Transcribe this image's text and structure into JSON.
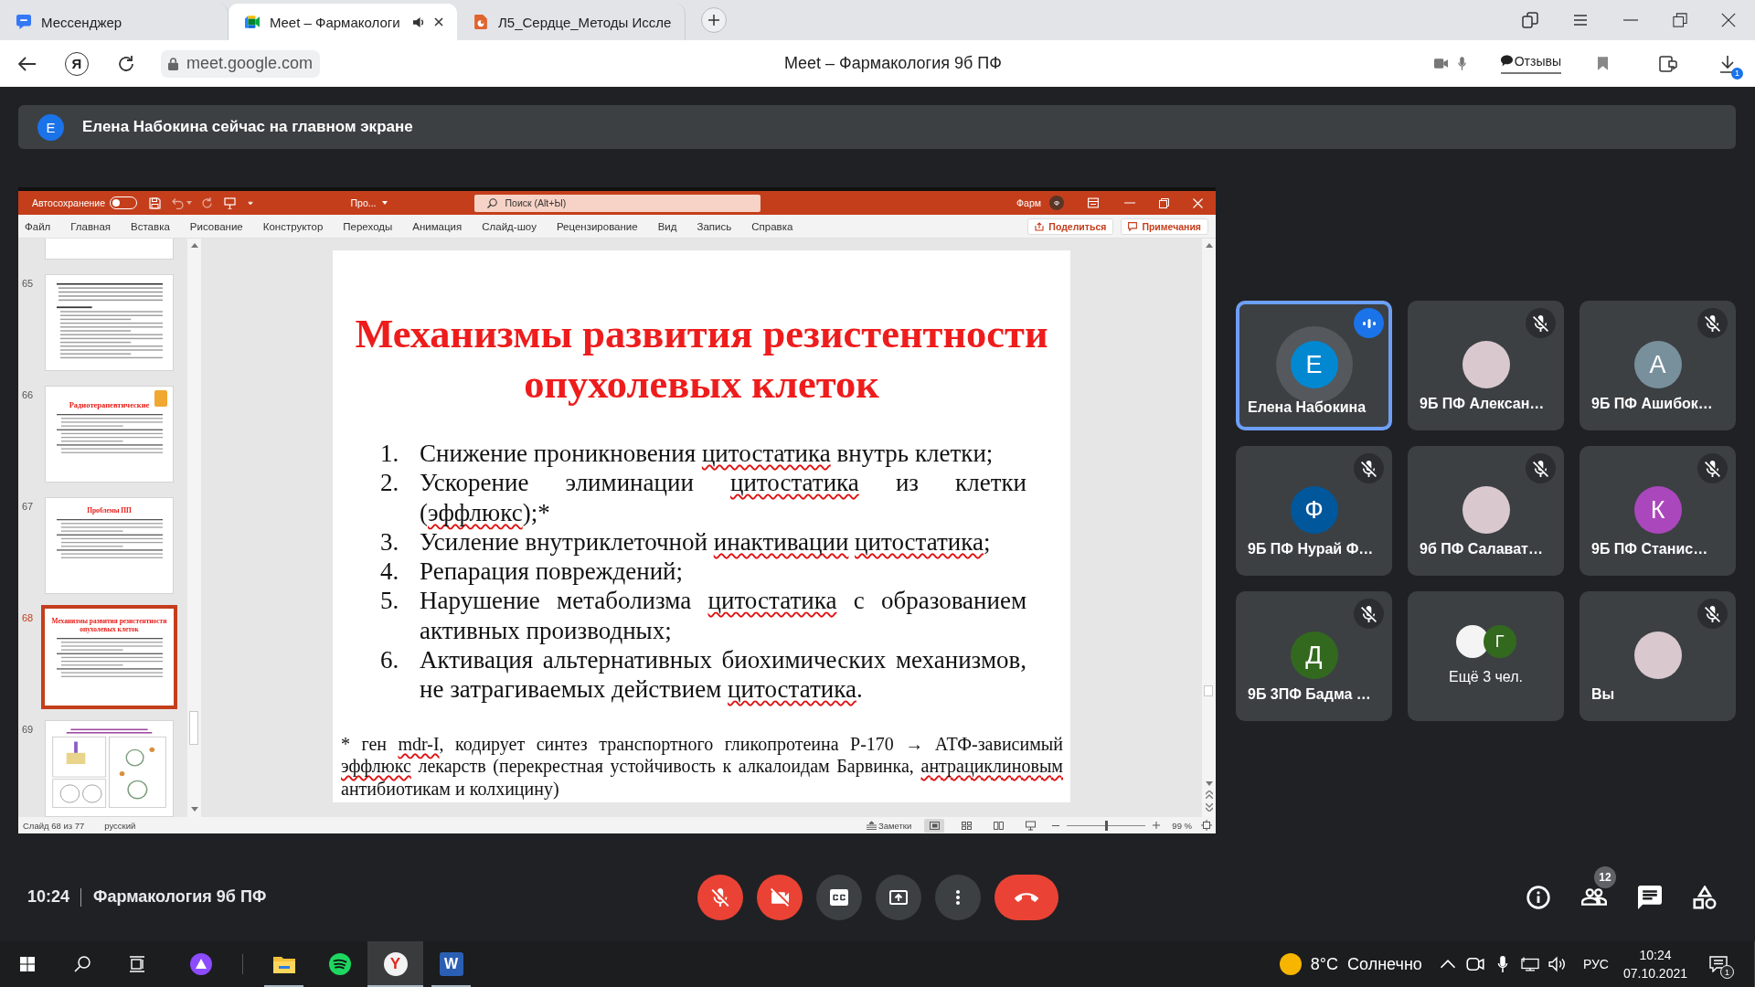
{
  "browser": {
    "tabs": [
      {
        "kind": "messenger",
        "title": "Мессенджер",
        "selected": false,
        "audio": false
      },
      {
        "kind": "meet",
        "title": "Meet – Фармакологи",
        "selected": true,
        "audio": true
      },
      {
        "kind": "document",
        "title": "Л5_Сердце_Методы Иссле",
        "selected": false,
        "audio": false
      }
    ],
    "home_glyph": "Я",
    "address": "meet.google.com",
    "page_title": "Meet – Фармакология 9б ПФ",
    "feedback": "Отзывы",
    "downloads_badge": "1"
  },
  "banner": {
    "avatar": "Е",
    "text": "Елена Набокина сейчас на главном экране"
  },
  "presentation": {
    "titlebar": {
      "autosave": "Автосохранение",
      "autosave_on": false,
      "file": "Про...",
      "search_placeholder": "Поиск (Alt+Ы)",
      "user": "Фарм",
      "user_avatar": "Ф"
    },
    "menu": [
      "Файл",
      "Главная",
      "Вставка",
      "Рисование",
      "Конструктор",
      "Переходы",
      "Анимация",
      "Слайд-шоу",
      "Рецензирование",
      "Вид",
      "Запись",
      "Справка"
    ],
    "share": "Поделиться",
    "comments": "Примечания",
    "thumbnails": [
      {
        "kind": "cut",
        "selected": false
      },
      {
        "number": "65",
        "kind": "text",
        "selected": false
      },
      {
        "number": "66",
        "kind": "title-image",
        "title": "Радиотерапевтические",
        "selected": false
      },
      {
        "number": "67",
        "kind": "title",
        "title": "Проблемы ПП",
        "selected": false
      },
      {
        "number": "68",
        "kind": "title",
        "title": "Механизмы развития резистентности опухолевых клеток",
        "selected": true
      },
      {
        "number": "69",
        "kind": "figure",
        "selected": false
      }
    ],
    "slide": {
      "title": "Механизмы развития резистентности опухолевых клеток",
      "items": [
        {
          "number": "1.",
          "parts": [
            {
              "text": "Снижение проникновения ",
              "misspelled": false
            },
            {
              "text": "цитостатика",
              "misspelled": true
            },
            {
              "text": " внутрь клетки;",
              "misspelled": false
            }
          ]
        },
        {
          "number": "2.",
          "parts": [
            {
              "text": "Ускорение элиминации ",
              "misspelled": false
            },
            {
              "text": "цитостатика",
              "misspelled": true
            },
            {
              "text": " из клетки (",
              "misspelled": false
            },
            {
              "text": "эффлюкс",
              "misspelled": true
            },
            {
              "text": ");*",
              "misspelled": false
            }
          ]
        },
        {
          "number": "3.",
          "parts": [
            {
              "text": "Усиление внутриклеточной ",
              "misspelled": false
            },
            {
              "text": "инактивации",
              "misspelled": true
            },
            {
              "text": " цитостатика",
              "misspelled": true
            },
            {
              "text": ";",
              "misspelled": false
            }
          ]
        },
        {
          "number": "4.",
          "parts": [
            {
              "text": "Репарация повреждений;",
              "misspelled": false
            }
          ]
        },
        {
          "number": "5.",
          "parts": [
            {
              "text": "Нарушение метаболизма ",
              "misspelled": false
            },
            {
              "text": "цитостатика",
              "misspelled": true
            },
            {
              "text": " с образованием активных производных;",
              "misspelled": false
            }
          ]
        },
        {
          "number": "6.",
          "parts": [
            {
              "text": "Активация альтернативных биохимических механизмов, не затрагиваемых действием ",
              "misspelled": false
            },
            {
              "text": "цитостатика",
              "misspelled": true
            },
            {
              "text": ".",
              "misspelled": false
            }
          ]
        }
      ],
      "footnote": [
        {
          "text": "* ген ",
          "misspelled": false
        },
        {
          "text": "mdr-I",
          "misspelled": true
        },
        {
          "text": ", кодирует синтез транспортного гликопротеина Р-170 → АТФ-зависимый ",
          "misspelled": false
        },
        {
          "text": "эффлюкс",
          "misspelled": true
        },
        {
          "text": " лекарств (перекрестная устойчивость к алкалоидам Барвинка, ",
          "misspelled": false
        },
        {
          "text": "антрациклиновым",
          "misspelled": true
        },
        {
          "text": " антибиотикам и колхицину)",
          "misspelled": false
        }
      ]
    },
    "status": {
      "slide": "Слайд 68 из 77",
      "language": "русский",
      "notes": "Заметки",
      "views": [
        {
          "kind": "normal",
          "selected": true
        },
        {
          "kind": "sorter",
          "selected": false
        },
        {
          "kind": "reading",
          "selected": false
        },
        {
          "kind": "slideshow",
          "selected": false
        }
      ],
      "zoom_slider": {
        "level": 0.5
      },
      "zoom": "99 %"
    }
  },
  "participants": [
    {
      "kind": "letter",
      "name": "Елена Набокина",
      "letter": "Е",
      "color": "#0288d1",
      "speaking": true,
      "muted": false
    },
    {
      "kind": "photo",
      "name": "9Б ПФ Алексан…",
      "speaking": false,
      "muted": true
    },
    {
      "kind": "letter",
      "name": "9Б ПФ Ашибок…",
      "letter": "А",
      "color": "#78909c",
      "speaking": false,
      "muted": true
    },
    {
      "kind": "letter",
      "name": "9Б ПФ Нурай Ф…",
      "letter": "Ф",
      "color": "#01579b",
      "speaking": false,
      "muted": true
    },
    {
      "kind": "photo",
      "name": "9б ПФ Салават…",
      "speaking": false,
      "muted": true
    },
    {
      "kind": "letter",
      "name": "9Б ПФ Станис…",
      "letter": "К",
      "color": "#ab47bc",
      "speaking": false,
      "muted": true
    },
    {
      "kind": "letter",
      "name": "9Б 3ПФ Бадма …",
      "letter": "Д",
      "color": "#33691e",
      "speaking": false,
      "muted": true
    },
    {
      "kind": "more",
      "label": "Ещё 3 чел.",
      "avatars": [
        {
          "kind": "photo"
        },
        {
          "kind": "letter",
          "letter": "Г",
          "color": "#33691e"
        }
      ],
      "speaking": false,
      "muted": false
    },
    {
      "kind": "photo",
      "name": "Вы",
      "speaking": false,
      "muted": true
    }
  ],
  "call": {
    "time": "10:24",
    "title": "Фармакология 9б ПФ",
    "controls": [
      {
        "kind": "mic",
        "on": false
      },
      {
        "kind": "camera",
        "on": false
      },
      {
        "kind": "captions",
        "on": false
      },
      {
        "kind": "present"
      },
      {
        "kind": "more"
      },
      {
        "kind": "leave"
      }
    ],
    "tools": [
      {
        "kind": "info"
      },
      {
        "kind": "people",
        "badge": "12"
      },
      {
        "kind": "chat"
      },
      {
        "kind": "activities"
      }
    ]
  },
  "taskbar": {
    "apps": [
      {
        "kind": "explorer",
        "running": true,
        "selected": false
      },
      {
        "kind": "music",
        "running": false,
        "selected": false
      },
      {
        "kind": "browser",
        "glyph": "Y",
        "running": true,
        "selected": true
      },
      {
        "kind": "word",
        "glyph": "W",
        "running": true,
        "selected": false
      }
    ],
    "weather": {
      "temperature": "8°C",
      "condition": "Солнечно"
    },
    "language": "РУС",
    "time": "10:24",
    "date": "07.10.2021",
    "notifications_badge": "1"
  }
}
